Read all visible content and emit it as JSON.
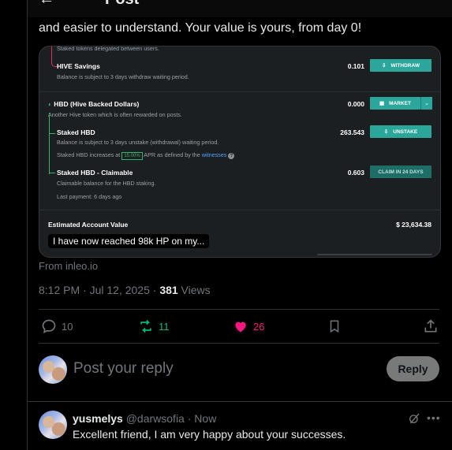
{
  "header": {
    "back_icon": "arrow-left-icon",
    "title": "Post"
  },
  "post": {
    "text_line": "and easier to understand. Your value is yours, from day 0!",
    "from": "From inleo.io",
    "time": "8:12 PM · Jul 12, 2025 · ",
    "views_count": "381",
    "views_label": " Views"
  },
  "card": {
    "delegated_note": "Staked tokens delegated between users.",
    "hive_savings": {
      "title": "HIVE Savings",
      "sub": "Balance is subject to 3 days withdraw waiting period.",
      "value": "0.101",
      "button": "WITHDRAW"
    },
    "hbd": {
      "title": "HBD (Hive Backed Dollars)",
      "sub": "Another Hive token which is often rewarded on posts.",
      "value": "0.000",
      "button": "MARKET"
    },
    "staked_hbd": {
      "title": "Staked HBD",
      "sub": "Balance is subject to 3 days unstake (withdrawal) waiting period.",
      "value": "263.543",
      "button": "UNSTAKE",
      "apr_prefix": "Staked HBD increases at",
      "apr_value": "15.00%",
      "apr_mid": "APR as defined by the",
      "apr_link": "witnesses",
      "apr_help": "?"
    },
    "claimable": {
      "title": "Staked HBD - Claimable",
      "sub": "Claimable balance for the HBD staking.",
      "value": "0.603",
      "button": "CLAIM IN 24 DAYS",
      "last_payment": "Last payment: 6 days ago"
    },
    "estimated": {
      "label": "Estimated Account Value",
      "value": "$ 23,634.38"
    },
    "caption": "I have now reached 98k HP on my..."
  },
  "actions": {
    "replies": {
      "icon": "reply-bubble-icon",
      "count": "10",
      "color": "#71767b"
    },
    "reposts": {
      "icon": "repost-icon",
      "count": "11",
      "color": "#00ba7c"
    },
    "likes": {
      "icon": "heart-icon",
      "count": "26",
      "color": "#f91880"
    },
    "bookmark": {
      "icon": "bookmark-icon"
    },
    "share": {
      "icon": "share-icon"
    }
  },
  "reply_box": {
    "placeholder": "Post your reply",
    "button": "Reply"
  },
  "comment": {
    "name": "yusmelys",
    "handle": "@darwsofia",
    "time": " · Now",
    "text": "Excellent friend, I am very happy about your successes.",
    "icons": [
      "grok-icon",
      "more-icon"
    ]
  },
  "colors": {
    "accent_green": "#00ba7c",
    "like_pink": "#f91880",
    "hive_teal": "#2aa69a"
  }
}
